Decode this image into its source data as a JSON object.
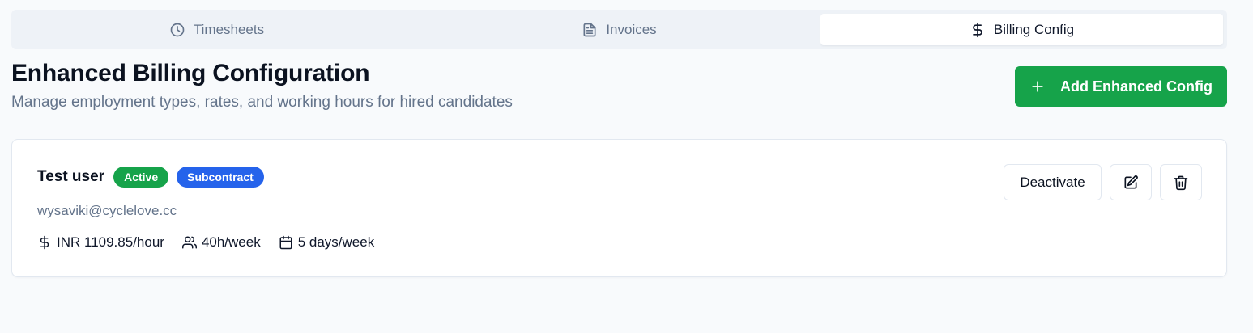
{
  "tabs": [
    {
      "label": "Timesheets",
      "icon": "clock-icon",
      "active": false
    },
    {
      "label": "Invoices",
      "icon": "file-text-icon",
      "active": false
    },
    {
      "label": "Billing Config",
      "icon": "dollar-icon",
      "active": true
    }
  ],
  "header": {
    "title": "Enhanced Billing Configuration",
    "subtitle": "Manage employment types, rates, and working hours for hired candidates",
    "add_button_label": "Add Enhanced Config"
  },
  "config_card": {
    "name": "Test user",
    "badges": [
      {
        "label": "Active",
        "color": "#16a34a"
      },
      {
        "label": "Subcontract",
        "color": "#2563eb"
      }
    ],
    "email": "wysaviki@cyclelove.cc",
    "rate": "INR 1109.85/hour",
    "hours": "40h/week",
    "days": "5 days/week",
    "deactivate_label": "Deactivate"
  },
  "colors": {
    "primary_green": "#16a34a",
    "badge_blue": "#2563eb",
    "muted_text": "#64748b"
  }
}
